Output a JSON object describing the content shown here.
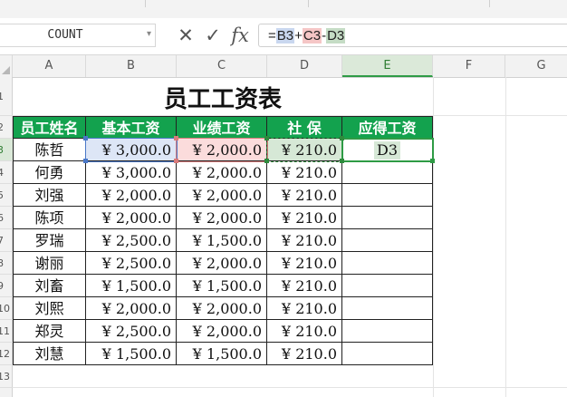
{
  "name_box": {
    "value": "COUNT"
  },
  "formula_bar": {
    "cancel_glyph": "✕",
    "confirm_glyph": "✓",
    "fx_glyph": "fx",
    "parts": [
      "=",
      "B3",
      "+",
      "C3",
      "-",
      "D3"
    ]
  },
  "columns": [
    "A",
    "B",
    "C",
    "D",
    "E",
    "F",
    "G"
  ],
  "rows": [
    "1",
    "2",
    "3",
    "4",
    "5",
    "6",
    "7",
    "8",
    "9",
    "10",
    "11",
    "12",
    "13"
  ],
  "sheet": {
    "title": "员工工资表",
    "headers": [
      "员工姓名",
      "基本工资",
      "业绩工资",
      "社  保",
      "应得工资"
    ],
    "data": [
      [
        "陈哲",
        "¥ 3,000.0",
        "¥ 2,000.0",
        "¥ 210.0",
        ""
      ],
      [
        "何勇",
        "¥ 3,000.0",
        "¥ 2,000.0",
        "¥ 210.0",
        ""
      ],
      [
        "刘强",
        "¥ 2,000.0",
        "¥ 2,000.0",
        "¥ 210.0",
        ""
      ],
      [
        "陈项",
        "¥ 2,000.0",
        "¥ 2,000.0",
        "¥ 210.0",
        ""
      ],
      [
        "罗瑞",
        "¥ 2,500.0",
        "¥ 1,500.0",
        "¥ 210.0",
        ""
      ],
      [
        "谢丽",
        "¥ 2,500.0",
        "¥ 2,000.0",
        "¥ 210.0",
        ""
      ],
      [
        "刘畜",
        "¥ 1,500.0",
        "¥ 1,500.0",
        "¥ 210.0",
        ""
      ],
      [
        "刘熙",
        "¥ 2,000.0",
        "¥ 2,000.0",
        "¥ 210.0",
        ""
      ],
      [
        "郑灵",
        "¥ 2,500.0",
        "¥ 2,000.0",
        "¥ 210.0",
        ""
      ],
      [
        "刘慧",
        "¥ 1,500.0",
        "¥ 1,500.0",
        "¥ 210.0",
        ""
      ]
    ],
    "editing_cell_text": "D3"
  },
  "colors": {
    "header_green": "#13a24e",
    "active_green": "#2e9b45",
    "ref_blue": "#4a78c8",
    "ref_red": "#d97b7b",
    "ref_green": "#2e8b3c"
  },
  "icons": [
    "dropdown-caret-icon",
    "cancel-icon",
    "confirm-icon",
    "fx-icon",
    "select-all-icon"
  ]
}
